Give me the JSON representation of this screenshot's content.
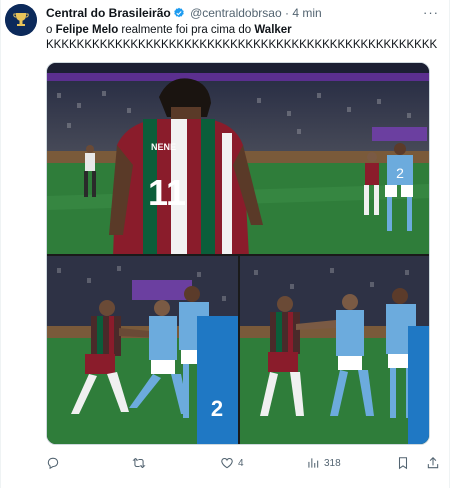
{
  "author": {
    "name": "Central do Brasileirão",
    "handle": "@centraldobrsao",
    "separator": "·",
    "time": "4 min"
  },
  "post": {
    "line1_prefix": "o ",
    "line1_name1": "Felipe Melo",
    "line1_middle": " realmente foi pra cima do ",
    "line1_name2": "Walker",
    "line2": "KKKKKKKKKKKKKKKKKKKKKKKKKKKKKKKKKKKKKKKKKKKKKKKKKKK"
  },
  "media": {
    "player_number": "11",
    "player_name": "NENE",
    "rival_number": "2",
    "rival_number_b": "2"
  },
  "actions": {
    "reply_count": "",
    "retweet_count": "",
    "like_count": "4",
    "views_count": "318"
  },
  "colors": {
    "verified": "#1d9bf0",
    "fluminense_red": "#8a1c2b",
    "fluminense_green": "#0b5e3a",
    "city_blue": "#6cabdd",
    "pitch": "#2f7d3a"
  }
}
